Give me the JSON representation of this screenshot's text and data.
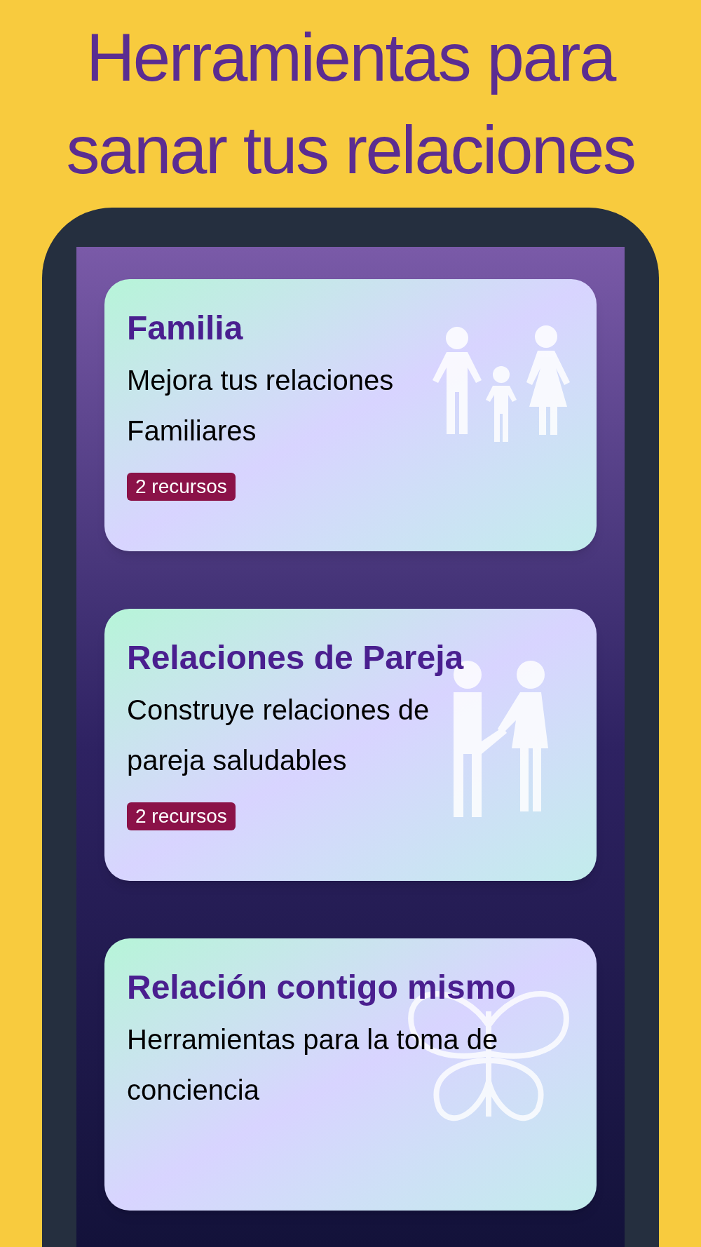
{
  "headline": "Herramientas para sanar tus relaciones",
  "cards": [
    {
      "title": "Familia",
      "description": "Mejora tus relaciones Familiares",
      "badge": "2 recursos",
      "kind": "family"
    },
    {
      "title": "Relaciones de Pareja",
      "description": "Construye relaciones de pareja saludables",
      "badge": "2 recursos",
      "kind": "couple"
    },
    {
      "title": "Relación contigo mismo",
      "description": "Herramientas para la toma de conciencia",
      "kind": "butterfly"
    }
  ]
}
